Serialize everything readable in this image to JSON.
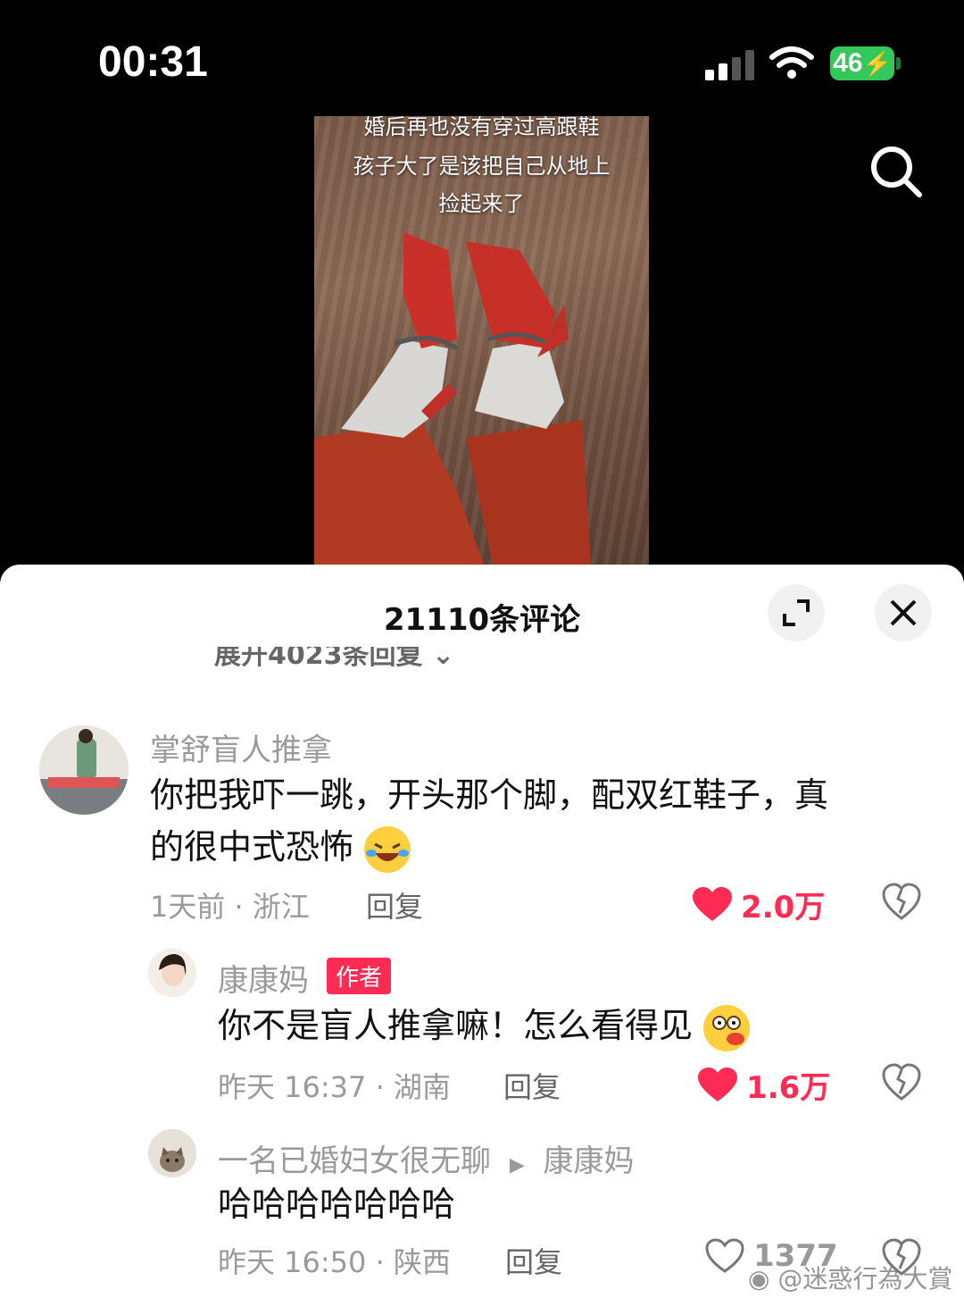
{
  "status_bar": {
    "time": "00:31",
    "battery": "46"
  },
  "video": {
    "caption_lines": [
      "婚后再也没有穿过高跟鞋",
      "孩子大了是该把自己从地上",
      "捡起来了"
    ]
  },
  "comments_sheet": {
    "title": "21110条评论",
    "expand_replies": "展开4023条回复",
    "comments": [
      {
        "name": "掌舒盲人推拿",
        "text_line1": "你把我吓一跳，开头那个脚，配双红鞋子，真",
        "text_line2": "的很中式恐怖",
        "meta": "1天前 · 浙江",
        "reply": "回复",
        "likes": "2.0万",
        "liked": true
      },
      {
        "name": "康康妈",
        "badge": "作者",
        "text": "你不是盲人推拿嘛！怎么看得见",
        "meta": "昨天 16:37 · 湖南",
        "reply": "回复",
        "likes": "1.6万",
        "liked": true
      },
      {
        "name": "一名已婚妇女很无聊",
        "reply_to": "康康妈",
        "text": "哈哈哈哈哈哈哈",
        "meta": "昨天 16:50 · 陕西",
        "reply": "回复",
        "likes": "1377",
        "liked": false
      }
    ]
  },
  "watermark": "@迷惑行為大賞",
  "colors": {
    "like_red": "#fe2c55",
    "battery_green": "#34c759"
  }
}
